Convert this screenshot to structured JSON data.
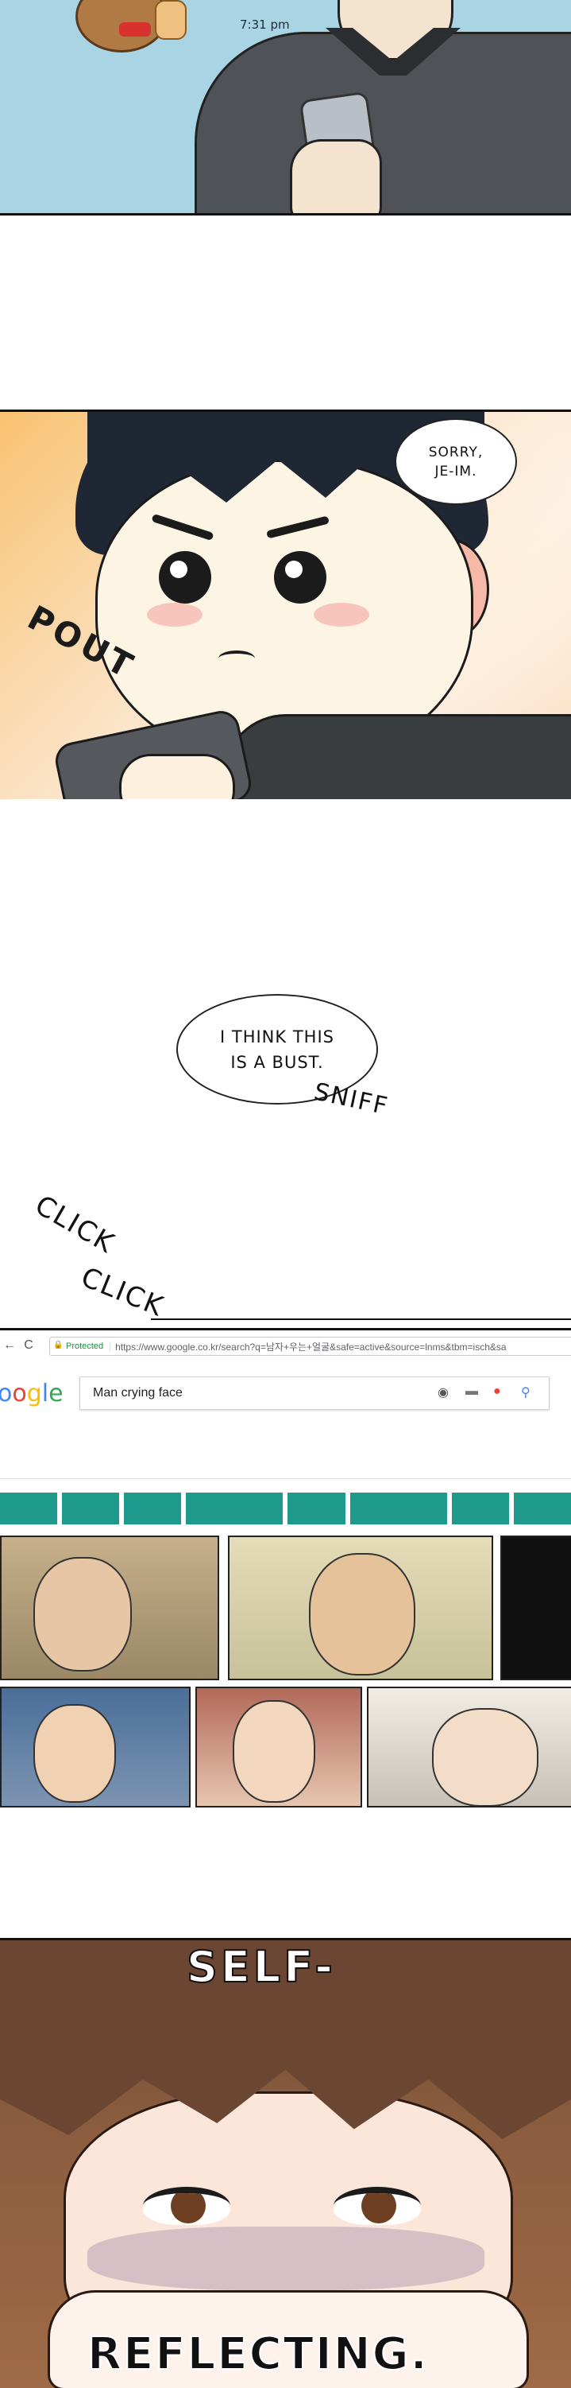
{
  "panel1": {
    "time": "7:31 pm"
  },
  "panel2": {
    "speech": "SORRY,\nJE-IM.",
    "sfx": "POUT"
  },
  "panel3": {
    "speech": "I THINK THIS\nIS A BUST.",
    "sfx_sniff": "SNIFF",
    "sfx_click1": "CLICK",
    "sfx_click2": "CLICK"
  },
  "browser": {
    "nav_back": "←",
    "nav_reload": "C",
    "nav_home": "⌂",
    "secure_label": "Protected",
    "url": "https://www.google.co.kr/search?q=남자+우는+얼굴&safe=active&source=lnms&tbm=isch&sa",
    "logo": [
      "o",
      "o",
      "g",
      "l",
      "e"
    ],
    "search_query": "Man crying face",
    "icons": [
      "camera-icon",
      "keyboard-icon",
      "mic-icon",
      "search-icon"
    ]
  },
  "panel5": {
    "text_top": "SELF-",
    "text_bottom": "REFLECTING."
  },
  "colors": {
    "tab_teal": "#1e9a8c",
    "sky": "#a9d4e4"
  }
}
